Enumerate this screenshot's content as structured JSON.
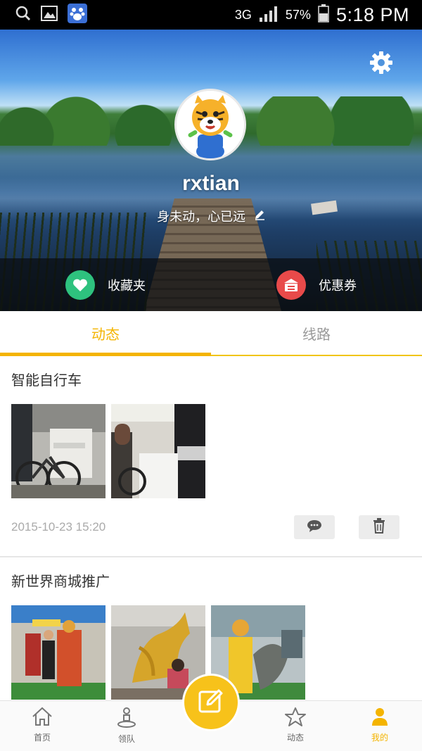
{
  "status_bar": {
    "network": "3G",
    "battery": "57%",
    "time": "5:18 PM",
    "left_icons": [
      "search-icon",
      "gallery-icon",
      "baidu-paw-icon"
    ],
    "right_icons": [
      "signal-icon",
      "battery-icon"
    ]
  },
  "profile": {
    "username": "rxtian",
    "signature": "身未动，心已远",
    "settings_icon": "gear-icon",
    "avatar": "tiger-mascot-avatar",
    "actions": [
      {
        "label": "收藏夹",
        "icon": "heart-icon",
        "color": "#2ec27e"
      },
      {
        "label": "优惠券",
        "icon": "ticket-icon",
        "color": "#e84a4a"
      }
    ]
  },
  "tabs": [
    {
      "label": "动态",
      "active": true
    },
    {
      "label": "线路",
      "active": false
    }
  ],
  "posts": [
    {
      "title": "智能自行车",
      "photos": [
        "bike-booth-photo",
        "bike-display-photo"
      ],
      "time": "2015-10-23 15:20",
      "actions": [
        "comment-icon",
        "trash-icon"
      ]
    },
    {
      "title": "新世界商城推广",
      "photos": [
        "costume-performers-photo",
        "golden-dragon-photo",
        "performer-yellow-costume-photo"
      ]
    }
  ],
  "bottom_nav": {
    "items": [
      {
        "label": "首页",
        "icon": "home-icon"
      },
      {
        "label": "领队",
        "icon": "leader-pin-icon"
      },
      {
        "label": "动态",
        "icon": "star-icon"
      },
      {
        "label": "我的",
        "icon": "person-icon",
        "active": true
      }
    ],
    "compose_icon": "edit-icon"
  },
  "colors": {
    "accent": "#f4b400",
    "fab": "#f7c21a",
    "inactive_tab": "#999999",
    "timestamp": "#aaaaaa"
  }
}
